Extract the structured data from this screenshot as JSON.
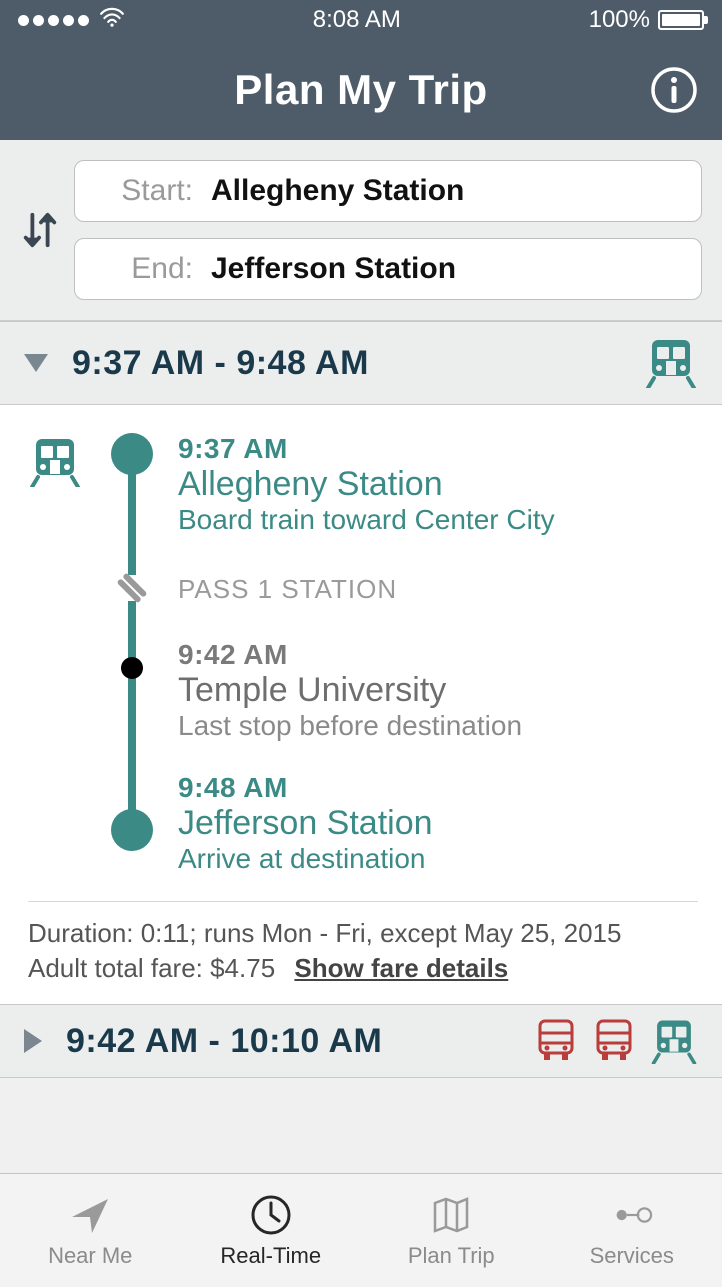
{
  "status": {
    "time": "8:08 AM",
    "battery": "100%"
  },
  "header": {
    "title": "Plan My Trip"
  },
  "inputs": {
    "start_label": "Start:",
    "start_value": "Allegheny Station",
    "end_label": "End:",
    "end_value": "Jefferson Station"
  },
  "option1": {
    "time_range": "9:37 AM - 9:48 AM",
    "stops": {
      "depart": {
        "time": "9:37 AM",
        "name": "Allegheny Station",
        "sub": "Board train toward Center City"
      },
      "pass": {
        "label": "PASS 1 STATION"
      },
      "mid": {
        "time": "9:42 AM",
        "name": "Temple University",
        "sub": "Last stop before destination"
      },
      "arrive": {
        "time": "9:48 AM",
        "name": "Jefferson Station",
        "sub": "Arrive at destination"
      }
    },
    "footer": {
      "duration_line": "Duration: 0:11; runs Mon - Fri, except May 25, 2015",
      "fare_line": "Adult total fare: $4.75",
      "fare_link": "Show fare details"
    }
  },
  "option2": {
    "time_range": "9:42 AM - 10:10 AM"
  },
  "tabs": {
    "near_me": "Near Me",
    "real_time": "Real-Time",
    "plan_trip": "Plan Trip",
    "services": "Services"
  }
}
